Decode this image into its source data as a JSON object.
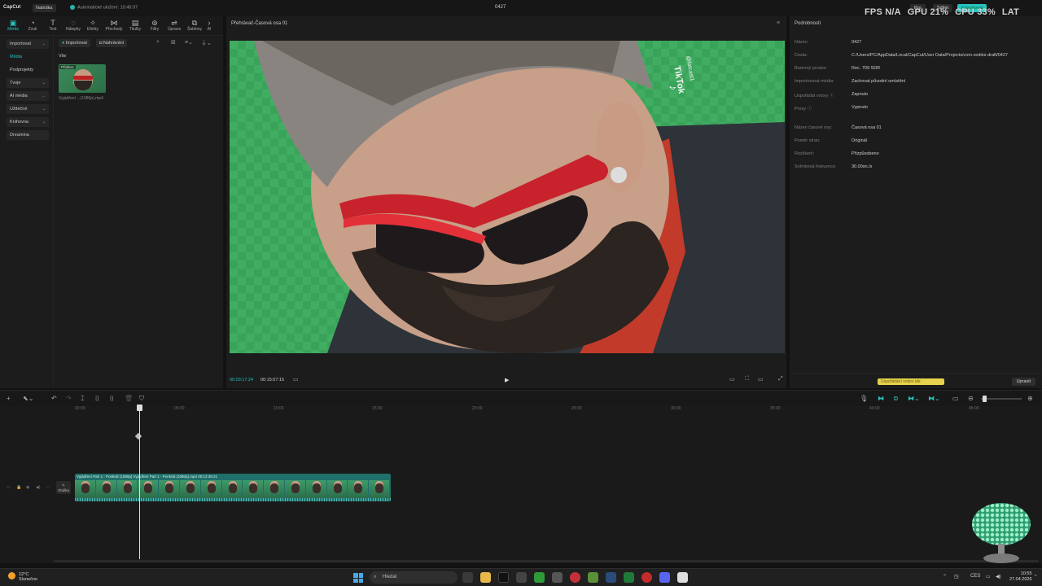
{
  "app": {
    "logo": "CapCut",
    "menu_label": "Nabídka",
    "autosave": "Automatické uložení: 10:45:07",
    "project_title": "0427",
    "perf": {
      "fps": "FPS N/A",
      "gpu": "GPU 21%",
      "cpu": "CPU 33%",
      "lat": "LAT N/A"
    },
    "header_buttons": {
      "pro": "Pro",
      "share": "Sdílet",
      "export": "Exportovat"
    }
  },
  "toolbar": [
    {
      "label": "Média",
      "icon": "▣"
    },
    {
      "label": "Zvuk",
      "icon": "◔"
    },
    {
      "label": "Text",
      "icon": "T"
    },
    {
      "label": "Nálepky",
      "icon": "◌"
    },
    {
      "label": "Efekty",
      "icon": "✧"
    },
    {
      "label": "Přechody",
      "icon": "⋈"
    },
    {
      "label": "Titulky",
      "icon": "▤"
    },
    {
      "label": "Filtry",
      "icon": "⊚"
    },
    {
      "label": "Úprava",
      "icon": "⇌"
    },
    {
      "label": "Šablony",
      "icon": "⧉"
    },
    {
      "label": "AI",
      "icon": "›"
    }
  ],
  "leftnav": {
    "import": "Importovat",
    "media": "Média",
    "subprojects": "Podprojekty",
    "yours": "Tvoje",
    "ai_media": "AI média",
    "useful": "Užitečné",
    "library": "Knihovna",
    "dreamina": "Dreamina"
  },
  "media": {
    "import_btn": "Importovat",
    "record_btn": "Nahrávání",
    "filter_all": "Vše",
    "thumb_tag": "Přidáno",
    "thumb_name": "Vyjádření ...(1080p).mp4"
  },
  "preview": {
    "title": "Přehrávač-Časová osa 01",
    "watermark_brand": "TikTok",
    "watermark_user": "@fatcast1",
    "time_current": "00:03:17:24",
    "time_total": "00:15:07:15"
  },
  "details": {
    "header": "Podrobnosti",
    "rows": [
      {
        "k": "Název:",
        "v": "0427"
      },
      {
        "k": "Cesta:",
        "v": "C:/Users/PC/AppData/Local/CapCut/User Data/Projects/com.veditor.draft/0427"
      },
      {
        "k": "Barevný prostor:",
        "v": "Rec. 709 SDR"
      },
      {
        "k": "Importovaná média:",
        "v": "Zachovat původní umístění"
      },
      {
        "k": "Uspořádat vrstvy ⓘ",
        "v": "Zapnuto"
      },
      {
        "k": "Proxy ⓘ",
        "v": "Vypnuto"
      },
      {
        "k": "Název časové osy:",
        "v": "Časová osa 01"
      },
      {
        "k": "Poměr stran:",
        "v": "Originál"
      },
      {
        "k": "Rozlišení:",
        "v": "Přizpůsobeno"
      },
      {
        "k": "Snímková frekvence:",
        "v": "30.00sn./s"
      }
    ],
    "tip": "Uspořádání vrstev ide",
    "edit_btn": "Upravit"
  },
  "timeline": {
    "ruler": [
      "00:00",
      "05:00",
      "10:00",
      "15:00",
      "20:00",
      "25:00",
      "30:00",
      "35:00",
      "40:00",
      "45:00"
    ],
    "cover_label": "Obálka",
    "clip_label": "Vyjádření Part 1 - Ponkrát (1080p)  Vyjádření Part 1 - Ponkrát (1080p).mp4  00:12:39:21"
  },
  "taskbar": {
    "temp": "12°C",
    "weather": "Slunečno",
    "search": "Hledat",
    "lang": "CES",
    "time": "10:55",
    "date": "27.04.2026"
  },
  "colors": {
    "accent": "#27c4c0",
    "clip": "#1f6f6a",
    "tip": "#e6d24c"
  }
}
